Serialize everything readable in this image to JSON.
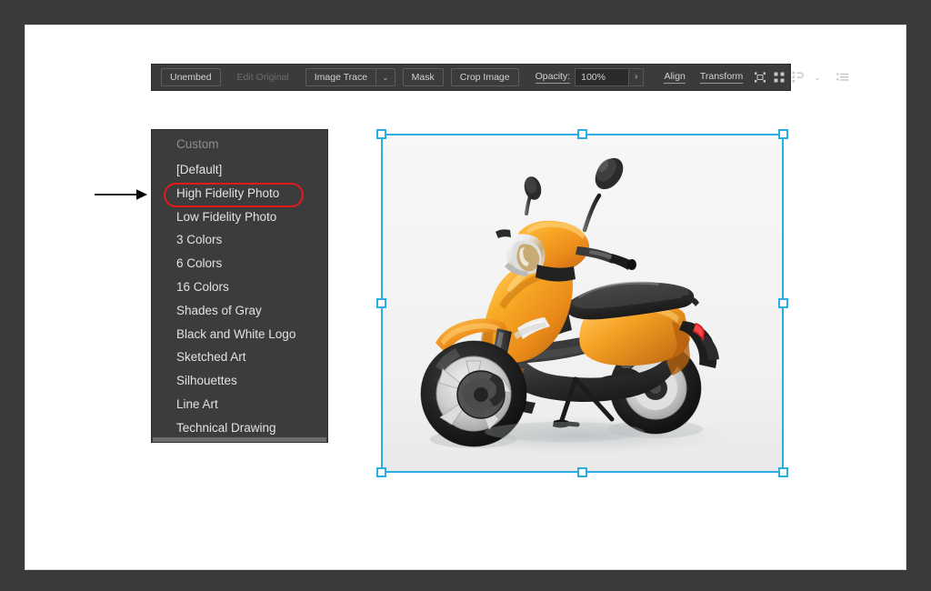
{
  "window": {
    "frame_color": "#3a3a3a",
    "canvas_color": "#ffffff"
  },
  "control_bar": {
    "unembed_label": "Unembed",
    "edit_original_label": "Edit Original",
    "image_trace_label": "Image Trace",
    "image_trace_caret": "⌄",
    "mask_label": "Mask",
    "crop_image_label": "Crop Image",
    "opacity_label": "Opacity:",
    "opacity_value": "100%",
    "opacity_stepper": "›",
    "align_label": "Align",
    "transform_label": "Transform",
    "icons": {
      "select_similar": "select-similar-objects-icon",
      "recolor_artwork": "recolor-artwork-icon",
      "arrange": "arrange-icon",
      "arrange_caret": "⌄",
      "options_menu": "options-menu-icon"
    }
  },
  "preset_menu": {
    "header": "Custom",
    "items": [
      {
        "label": "[Default]",
        "highlighted": false
      },
      {
        "label": "High Fidelity Photo",
        "highlighted": true
      },
      {
        "label": "Low Fidelity Photo",
        "highlighted": false
      },
      {
        "label": "3 Colors",
        "highlighted": false
      },
      {
        "label": "6 Colors",
        "highlighted": false
      },
      {
        "label": "16 Colors",
        "highlighted": false
      },
      {
        "label": "Shades of Gray",
        "highlighted": false
      },
      {
        "label": "Black and White Logo",
        "highlighted": false
      },
      {
        "label": "Sketched Art",
        "highlighted": false
      },
      {
        "label": "Silhouettes",
        "highlighted": false
      },
      {
        "label": "Line Art",
        "highlighted": false
      },
      {
        "label": "Technical Drawing",
        "highlighted": false
      }
    ],
    "background_color": "#3c3c3c",
    "text_color": "#e2e2e2",
    "header_color": "#8d8d8d"
  },
  "annotations": {
    "highlight_color": "#e01b18",
    "highlight_target": "High Fidelity Photo",
    "arrow_color": "#000000",
    "arrow_direction": "right"
  },
  "selection": {
    "accent_color": "#29ade3",
    "handle_fill": "#ffffff",
    "handle_count": 8
  },
  "artwork": {
    "subject": "orange scooter",
    "body_color": "#f0a01e",
    "body_color_dark": "#c9741a",
    "trim_color": "#2c2c2c",
    "background_color": "#f4f4f4"
  }
}
